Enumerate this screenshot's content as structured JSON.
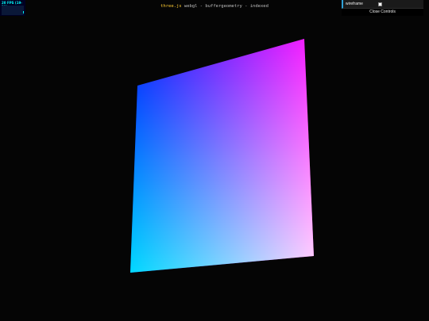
{
  "stats": {
    "fps_text": "20 FPS (19-28)"
  },
  "title": {
    "library": "three.js",
    "rest": " webgl - buffergeometry - indexed"
  },
  "gui": {
    "wireframe_label": "wireframe",
    "wireframe_checked": false,
    "close_label": "Close Controls"
  },
  "scene": {
    "background": "#050505",
    "vertex_colors": {
      "top_left": "#0000ff",
      "top_right": "#ff00ff",
      "bottom_left": "#00ffff",
      "bottom_right": "#ffffff"
    }
  }
}
